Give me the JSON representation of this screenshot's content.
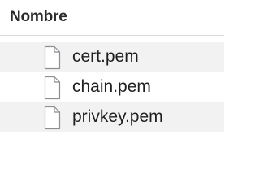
{
  "header": {
    "name_column": "Nombre"
  },
  "files": [
    {
      "name": "cert.pem",
      "icon": "document-icon"
    },
    {
      "name": "chain.pem",
      "icon": "document-icon"
    },
    {
      "name": "privkey.pem",
      "icon": "document-icon"
    }
  ],
  "colors": {
    "alt_row": "#f2f2f3",
    "divider": "#dcdcdc"
  }
}
